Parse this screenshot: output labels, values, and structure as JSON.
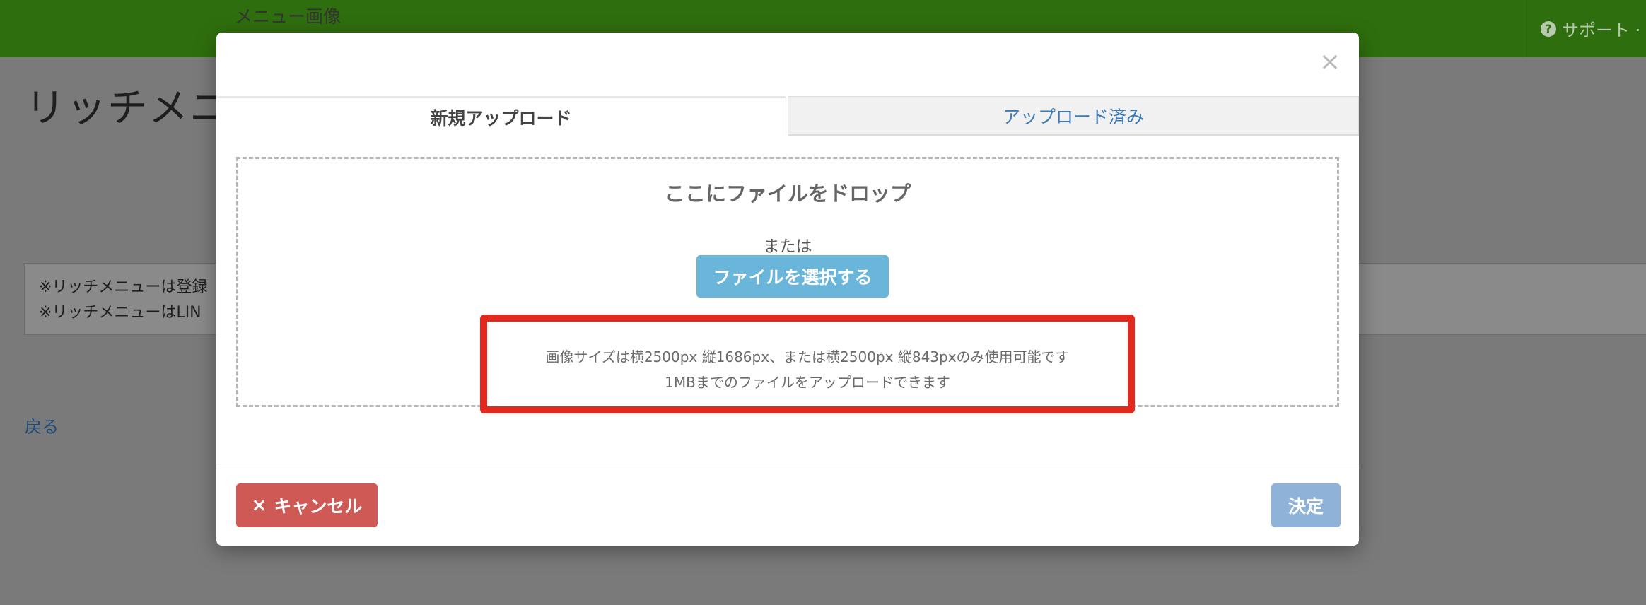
{
  "header": {
    "support_label": "サポート ·"
  },
  "page": {
    "title": "リッチメニ",
    "notice_lines": [
      "※リッチメニューは登録",
      "※リッチメニューはLIN"
    ],
    "back_link": "戻る"
  },
  "modal": {
    "title": "メニュー画像",
    "close_label": "×",
    "tabs": [
      {
        "label": "新規アップロード",
        "active": true
      },
      {
        "label": "アップロード済み",
        "active": false
      }
    ],
    "dropzone": {
      "title": "ここにファイルをドロップ",
      "or_text": "または",
      "select_button": "ファイルを選択する",
      "size_note_line1": "画像サイズは横2500px 縦1686px、または横2500px 縦843pxのみ使用可能です",
      "size_note_line2": "1MBまでのファイルをアップロードできます"
    },
    "cancel_label": "キャンセル",
    "cancel_icon": "×",
    "confirm_label": "決定"
  },
  "colors": {
    "topbar": "#2f6e0e",
    "highlight": "#e3281d",
    "primary_button": "#6ab6da",
    "cancel_button": "#cf5a55",
    "confirm_button": "#8fb3d8",
    "tab_link": "#3a7ab8"
  }
}
